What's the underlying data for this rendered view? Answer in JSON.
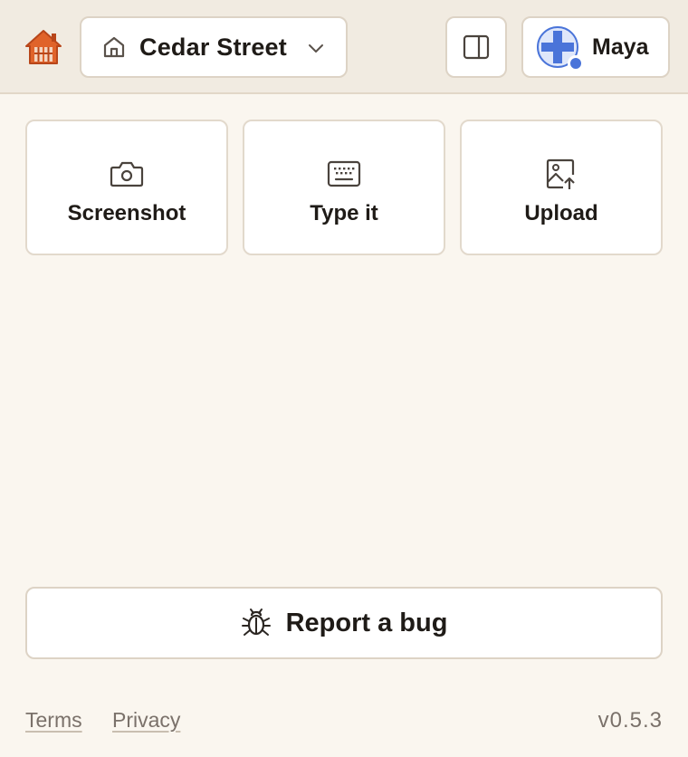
{
  "header": {
    "logo_icon": "house-logo-icon",
    "home_selector": {
      "icon": "home-icon",
      "label": "Cedar Street",
      "chevron": "chevron-down-icon"
    },
    "panel_toggle_icon": "sidebar-panel-icon",
    "user": {
      "name": "Maya",
      "avatar_icon": "plus-avatar-icon",
      "status_color": "#4a74d9"
    }
  },
  "actions": [
    {
      "label": "Screenshot",
      "icon": "camera-icon"
    },
    {
      "label": "Type it",
      "icon": "keyboard-icon"
    },
    {
      "label": "Upload",
      "icon": "image-upload-icon"
    }
  ],
  "report_bug": {
    "label": "Report a bug",
    "icon": "bug-icon"
  },
  "footer": {
    "links": [
      {
        "label": "Terms"
      },
      {
        "label": "Privacy"
      }
    ],
    "version": "v0.5.3"
  },
  "colors": {
    "accent": "#4a74d9",
    "logo": "#e0632a",
    "background": "#faf6ef"
  }
}
